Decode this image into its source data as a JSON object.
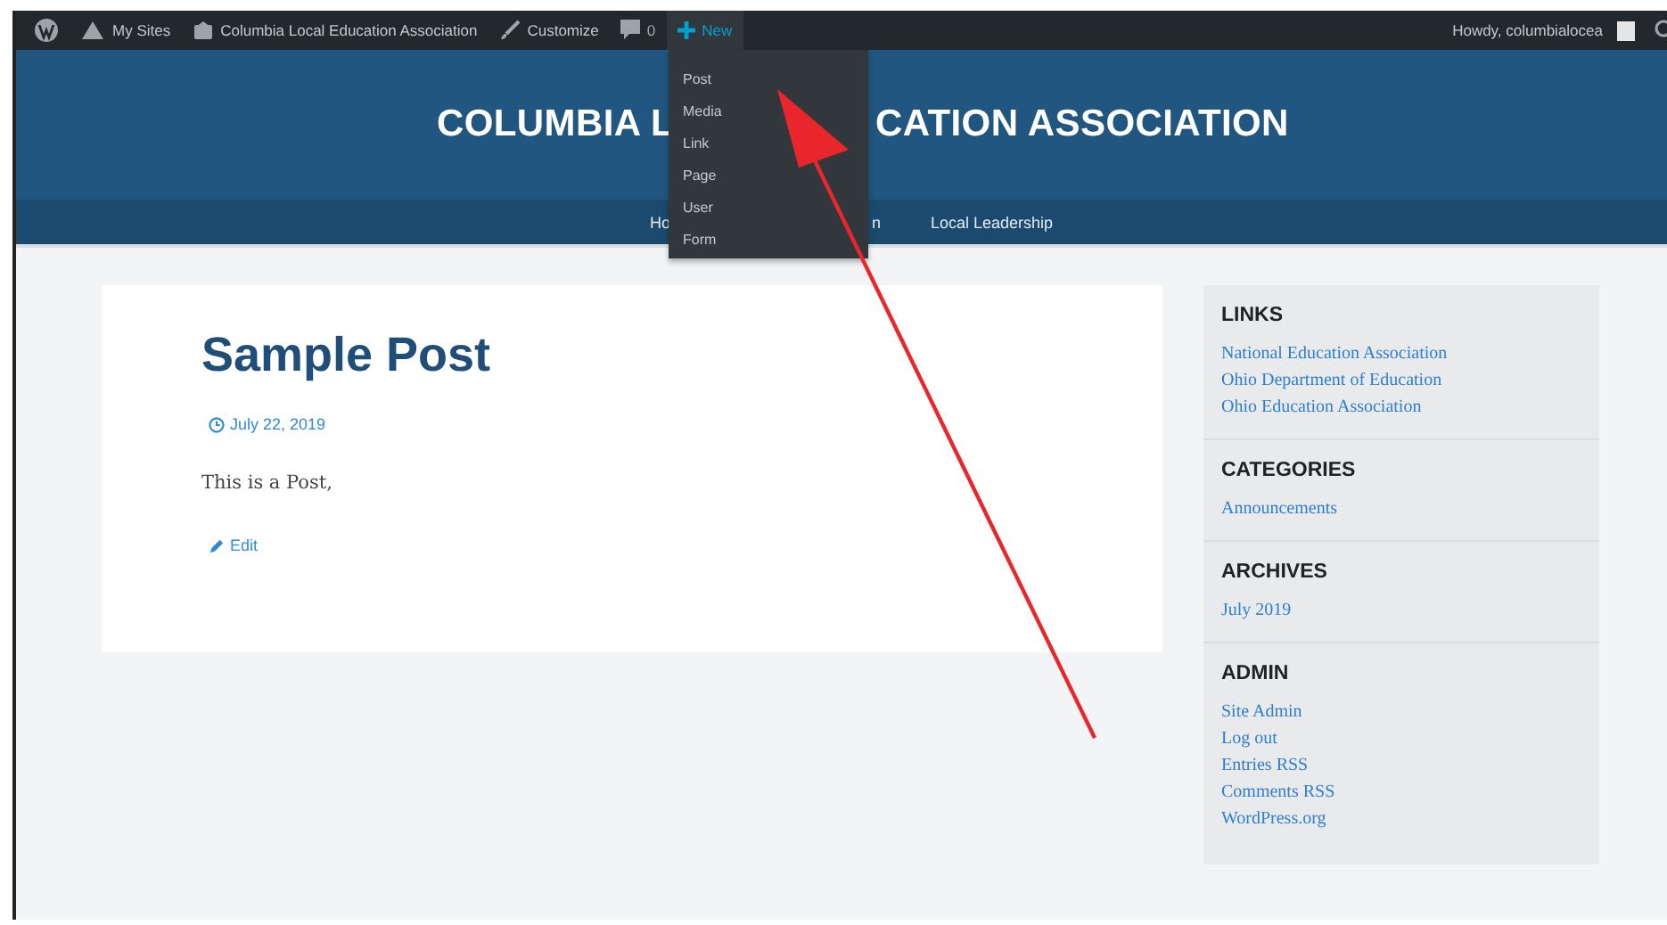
{
  "admin_bar": {
    "items": [
      {
        "kind": "logo"
      },
      {
        "kind": "sites",
        "label": "My Sites"
      },
      {
        "kind": "home",
        "label": "Columbia Local Education Association"
      },
      {
        "kind": "brush",
        "label": "Customize"
      },
      {
        "kind": "comments",
        "label": "0"
      },
      {
        "kind": "new",
        "label": "New"
      }
    ],
    "greeting": "Howdy, columbialocea"
  },
  "new_menu": {
    "open": true,
    "items": [
      "Post",
      "Media",
      "Link",
      "Page",
      "User",
      "Form"
    ]
  },
  "header": {
    "title_left": "COLUMBIA L",
    "title_right": "CATION ASSOCIATION",
    "nav_left": [
      "Ho"
    ],
    "nav_right": [
      "n",
      "Local Leadership"
    ]
  },
  "post": {
    "title": "Sample Post",
    "date": "July 22, 2019",
    "body": "This is a Post,",
    "edit": "Edit"
  },
  "sidebar": [
    {
      "heading": "LINKS",
      "links": [
        "National Education Association",
        "Ohio Department of Education",
        "Ohio Education Association"
      ]
    },
    {
      "heading": "CATEGORIES",
      "links": [
        "Announcements"
      ]
    },
    {
      "heading": "ARCHIVES",
      "links": [
        "July 2019"
      ]
    },
    {
      "heading": "ADMIN",
      "links": [
        "Site Admin",
        "Log out",
        "Entries RSS",
        "Comments RSS",
        "WordPress.org"
      ]
    }
  ]
}
